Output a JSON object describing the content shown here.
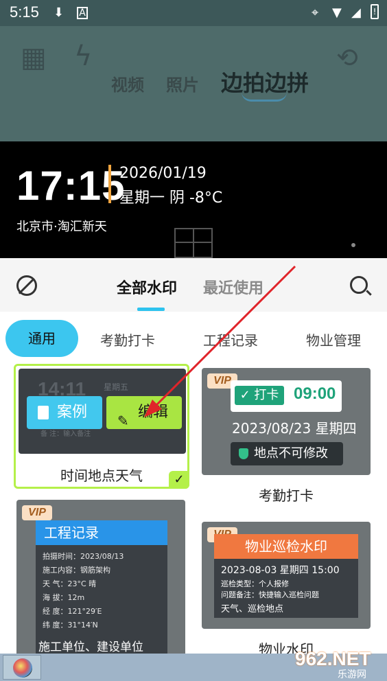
{
  "status_bar": {
    "time": "5:15",
    "icons": [
      "download-icon",
      "a-icon",
      "location-icon",
      "wifi-icon",
      "signal-icon",
      "battery-icon"
    ]
  },
  "camera": {
    "modes": [
      "视频",
      "照片",
      "边拍边拼"
    ],
    "active_mode": "边拍边拼",
    "top_icons": [
      "grid-icon",
      "flash-off-icon",
      "switch-camera-icon"
    ]
  },
  "watermark_preview": {
    "time": "17:15",
    "date": "2026/01/19",
    "weather": "星期一  阴  -8°C",
    "location": "北京市·淘汇新天"
  },
  "tabs": {
    "all": "全部水印",
    "recent": "最近使用",
    "active": "全部水印"
  },
  "categories": [
    "通用",
    "考勤打卡",
    "工程记录",
    "物业管理"
  ],
  "active_category": "通用",
  "templates": {
    "time_place_weather": {
      "label": "时间地点天气",
      "ghost_time": "14:11",
      "ghost_day": "星期五",
      "ghost_note": "备 注：输入备注",
      "case_button": "案例",
      "edit_button": "编辑",
      "selected": true
    },
    "attendance": {
      "label": "考勤打卡",
      "vip": "VIP",
      "tag": "打卡",
      "time": "09:00",
      "date": "2023/08/23 星期四",
      "lock_text": "地点不可修改"
    },
    "engineering": {
      "vip": "VIP",
      "title": "工程记录",
      "lines": [
        "拍摄时间：2023/08/13",
        "施工内容：钢筋架构",
        "天      气：23°C 晴",
        "海      拔：12m",
        "经      度：121°29′E",
        "纬      度：31°14′N"
      ],
      "footer": "施工单位、建设单位"
    },
    "property": {
      "label": "物业水印",
      "vip": "VIP",
      "title": "物业巡检水印",
      "datetime": "2023-08-03 星期四 15:00",
      "type_line": "巡检类型：个人报修",
      "note_line": "问题备注：快捷输入巡检问题",
      "footer": "天气、巡检地点"
    }
  },
  "branding": {
    "main": "962.NET",
    "sub": "乐游网"
  },
  "colors": {
    "accent": "#2ec3ee",
    "selected_border": "#b4f049",
    "vip_bg": "#fbe0c4",
    "arrow": "#e0242a"
  }
}
